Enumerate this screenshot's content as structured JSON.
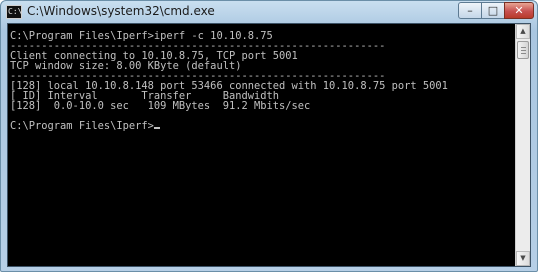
{
  "window": {
    "title": "C:\\Windows\\system32\\cmd.exe",
    "icon": "cmd-icon",
    "icon_text": "C:\\",
    "controls": {
      "minimize": "–",
      "maximize": "□",
      "close": "✕"
    }
  },
  "console": {
    "lines": [
      "C:\\Program Files\\Iperf>iperf -c 10.10.8.75",
      "------------------------------------------------------------",
      "Client connecting to 10.10.8.75, TCP port 5001",
      "TCP window size: 8.00 KByte (default)",
      "------------------------------------------------------------",
      "[128] local 10.10.8.148 port 53466 connected with 10.10.8.75 port 5001",
      "[ ID] Interval       Transfer     Bandwidth",
      "[128]  0.0-10.0 sec   109 MBytes  91.2 Mbits/sec",
      "",
      "C:\\Program Files\\Iperf>"
    ],
    "text_color": "#c0c0c0",
    "background_color": "#000000"
  },
  "scrollbar": {
    "up_arrow": "▲",
    "down_arrow": "▼"
  }
}
